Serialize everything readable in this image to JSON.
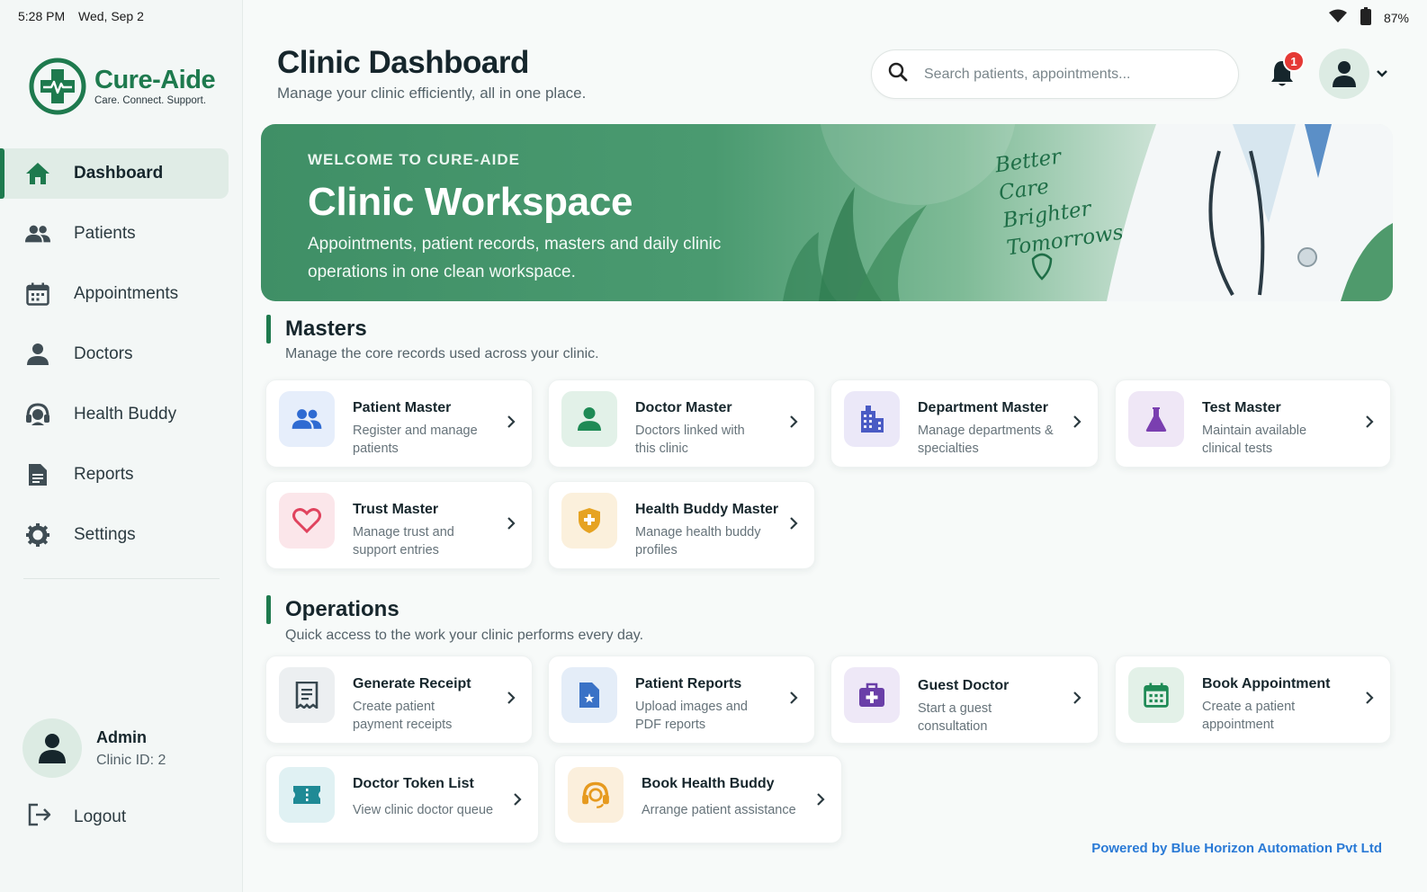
{
  "status": {
    "time": "5:28 PM",
    "date": "Wed, Sep 2",
    "battery": "87%"
  },
  "brand": {
    "name": "Cure-Aide",
    "tagline": "Care. Connect. Support."
  },
  "sidebar": {
    "items": [
      {
        "label": "Dashboard",
        "icon": "home-icon",
        "active": true
      },
      {
        "label": "Patients",
        "icon": "people-icon"
      },
      {
        "label": "Appointments",
        "icon": "calendar-icon"
      },
      {
        "label": "Doctors",
        "icon": "person-icon"
      },
      {
        "label": "Health Buddy",
        "icon": "headset-icon"
      },
      {
        "label": "Reports",
        "icon": "report-icon"
      },
      {
        "label": "Settings",
        "icon": "gear-icon"
      }
    ],
    "user": {
      "name": "Admin",
      "clinic_id": "Clinic ID: 2"
    },
    "logout_label": "Logout"
  },
  "header": {
    "title": "Clinic Dashboard",
    "subtitle": "Manage your clinic efficiently, all in one place.",
    "search_placeholder": "Search patients, appointments...",
    "notification_count": "1"
  },
  "banner": {
    "kicker": "WELCOME TO CURE-AIDE",
    "title": "Clinic Workspace",
    "description": "Appointments, patient records, masters and daily clinic operations in one clean workspace.",
    "script_lines": [
      "Better",
      "Care",
      "Brighter",
      "Tomorrows"
    ]
  },
  "masters": {
    "title": "Masters",
    "subtitle": "Manage the core records used across your clinic.",
    "cards": [
      {
        "title": "Patient Master",
        "desc": "Register and manage patients",
        "icon": "people-icon"
      },
      {
        "title": "Doctor Master",
        "desc": "Doctors linked with this clinic",
        "icon": "person-icon"
      },
      {
        "title": "Department Master",
        "desc": "Manage departments & specialties",
        "icon": "building-icon"
      },
      {
        "title": "Test Master",
        "desc": "Maintain available clinical tests",
        "icon": "flask-icon"
      },
      {
        "title": "Trust Master",
        "desc": "Manage trust and support entries",
        "icon": "heart-icon"
      },
      {
        "title": "Health Buddy Master",
        "desc": "Manage health buddy profiles",
        "icon": "shield-plus-icon"
      }
    ]
  },
  "operations": {
    "title": "Operations",
    "subtitle": "Quick access to the work your clinic performs every day.",
    "cards": [
      {
        "title": "Generate Receipt",
        "desc": "Create patient payment receipts",
        "icon": "receipt-icon"
      },
      {
        "title": "Patient Reports",
        "desc": "Upload images and PDF reports",
        "icon": "file-image-icon"
      },
      {
        "title": "Guest Doctor",
        "desc": "Start a guest consultation",
        "icon": "medical-bag-icon"
      },
      {
        "title": "Book Appointment",
        "desc": "Create a patient appointment",
        "icon": "calendar-icon"
      },
      {
        "title": "Doctor Token List",
        "desc": "View clinic doctor queue",
        "icon": "ticket-icon"
      },
      {
        "title": "Book Health Buddy",
        "desc": "Arrange patient assistance",
        "icon": "headset-icon"
      }
    ]
  },
  "footer": {
    "text": "Powered by Blue Horizon Automation Pvt Ltd"
  },
  "colors": {
    "brand_green": "#1e7a4e",
    "footer_blue": "#2a7ad6",
    "badge_red": "#e53935"
  }
}
